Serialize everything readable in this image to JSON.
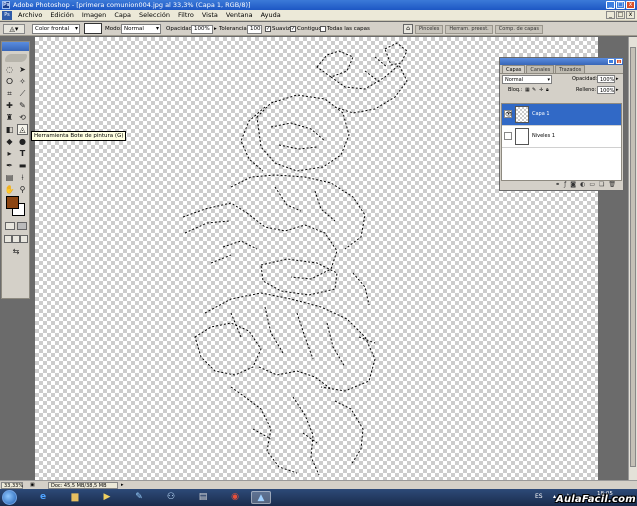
{
  "window": {
    "title": "Adobe Photoshop - [primera comunion004.jpg al 33,3% (Capa 1, RGB/8)]",
    "buttons": [
      "_",
      "□",
      "x"
    ]
  },
  "menu": {
    "items": [
      "Archivo",
      "Edición",
      "Imagen",
      "Capa",
      "Selección",
      "Filtro",
      "Vista",
      "Ventana",
      "Ayuda"
    ]
  },
  "options": {
    "fill_source": "Color frontal",
    "mode_label": "Modo:",
    "mode_value": "Normal",
    "opacity_label": "Opacidad:",
    "opacity_value": "100%",
    "tolerance_label": "Tolerancia:",
    "tolerance_value": "100",
    "smooth_label": "Suavizar",
    "contiguous_label": "Contiguo",
    "all_layers_label": "Todas las capas",
    "palette_well": [
      "Pinceles",
      "Herram. preest.",
      "Comp. de capas"
    ]
  },
  "toolbox": {
    "tooltip": "Herramienta Bote de pintura (G)",
    "foreground_color": "#8B4513",
    "background_color": "#FFFFFF"
  },
  "layers_panel": {
    "tabs": [
      "Capas",
      "Canales",
      "Trazados"
    ],
    "blend_mode": "Normal",
    "opacity_label": "Opacidad:",
    "opacity_value": "100%",
    "lock_label": "Bloq.:",
    "fill_label": "Relleno:",
    "fill_value": "100%",
    "layers": [
      {
        "name": "Capa 1",
        "selected": true,
        "visible": true
      },
      {
        "name": "Niveles 1",
        "selected": false,
        "visible": false
      }
    ]
  },
  "status": {
    "zoom": "33,33%",
    "doc_info": "Doc: 45,5 MB/38,5 MB"
  },
  "taskbar": {
    "language": "ES",
    "time": "18:05",
    "watermark": "AulaFacil.com"
  }
}
